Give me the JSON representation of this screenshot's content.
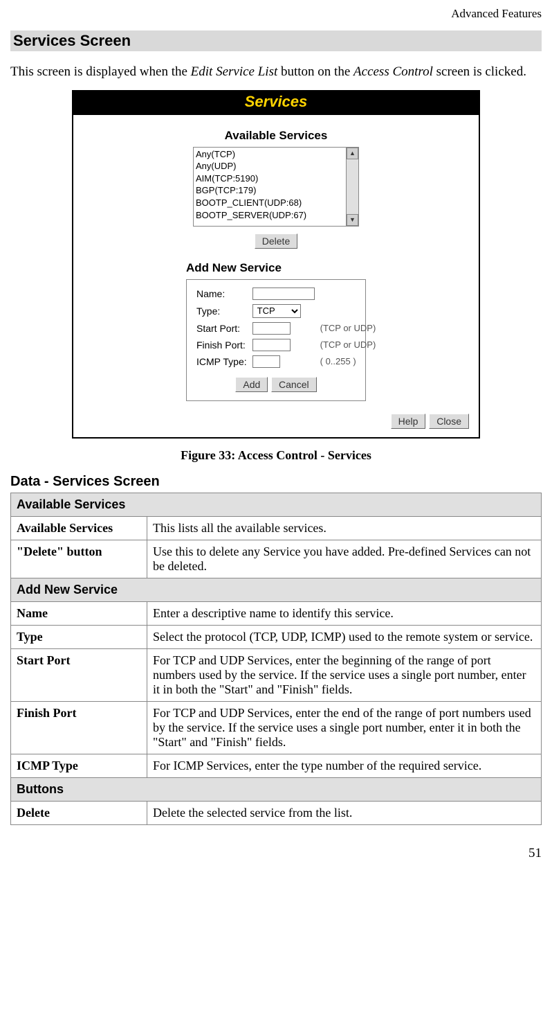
{
  "header": "Advanced Features",
  "section_heading": "Services Screen",
  "intro_pre": "This screen is displayed when the ",
  "intro_em1": "Edit Service List",
  "intro_mid": " button on the ",
  "intro_em2": "Access Control",
  "intro_post": " screen is clicked.",
  "figure": {
    "titlebar": "Services",
    "avail_title": "Available Services",
    "services": [
      "Any(TCP)",
      "Any(UDP)",
      "AIM(TCP:5190)",
      "BGP(TCP:179)",
      "BOOTP_CLIENT(UDP:68)",
      "BOOTP_SERVER(UDP:67)"
    ],
    "delete_btn": "Delete",
    "add_title": "Add New Service",
    "labels": {
      "name": "Name:",
      "type": "Type:",
      "start": "Start Port:",
      "finish": "Finish Port:",
      "icmp": "ICMP Type:"
    },
    "type_value": "TCP",
    "hint_port": "(TCP or UDP)",
    "hint_icmp": "( 0..255 )",
    "add_btn": "Add",
    "cancel_btn": "Cancel",
    "help_btn": "Help",
    "close_btn": "Close"
  },
  "caption": "Figure 33: Access Control - Services",
  "data_heading": "Data - Services Screen",
  "table": {
    "group1": "Available Services",
    "r1a": "Available Services",
    "r1b": "This lists all the available services.",
    "r2a": "\"Delete\" button",
    "r2b": "Use this to delete any Service you have added. Pre-defined Services can not be deleted.",
    "group2": "Add New Service",
    "r3a": "Name",
    "r3b": "Enter a descriptive name to identify this service.",
    "r4a": "Type",
    "r4b": "Select the protocol (TCP, UDP, ICMP) used to the remote system or service.",
    "r5a": "Start Port",
    "r5b": "For TCP and UDP Services, enter the beginning of the range of port numbers used by the service. If the service uses a single port number, enter it in both the \"Start\" and \"Finish\" fields.",
    "r6a": "Finish Port",
    "r6b": "For TCP and UDP Services, enter the end of the range of port numbers used by the service. If the service uses a single port number, enter it in both the \"Start\" and \"Finish\" fields.",
    "r7a": "ICMP Type",
    "r7b": "For ICMP Services, enter the type number of the required service.",
    "group3": "Buttons",
    "r8a": "Delete",
    "r8b": "Delete the selected service from the list."
  },
  "page_no": "51"
}
